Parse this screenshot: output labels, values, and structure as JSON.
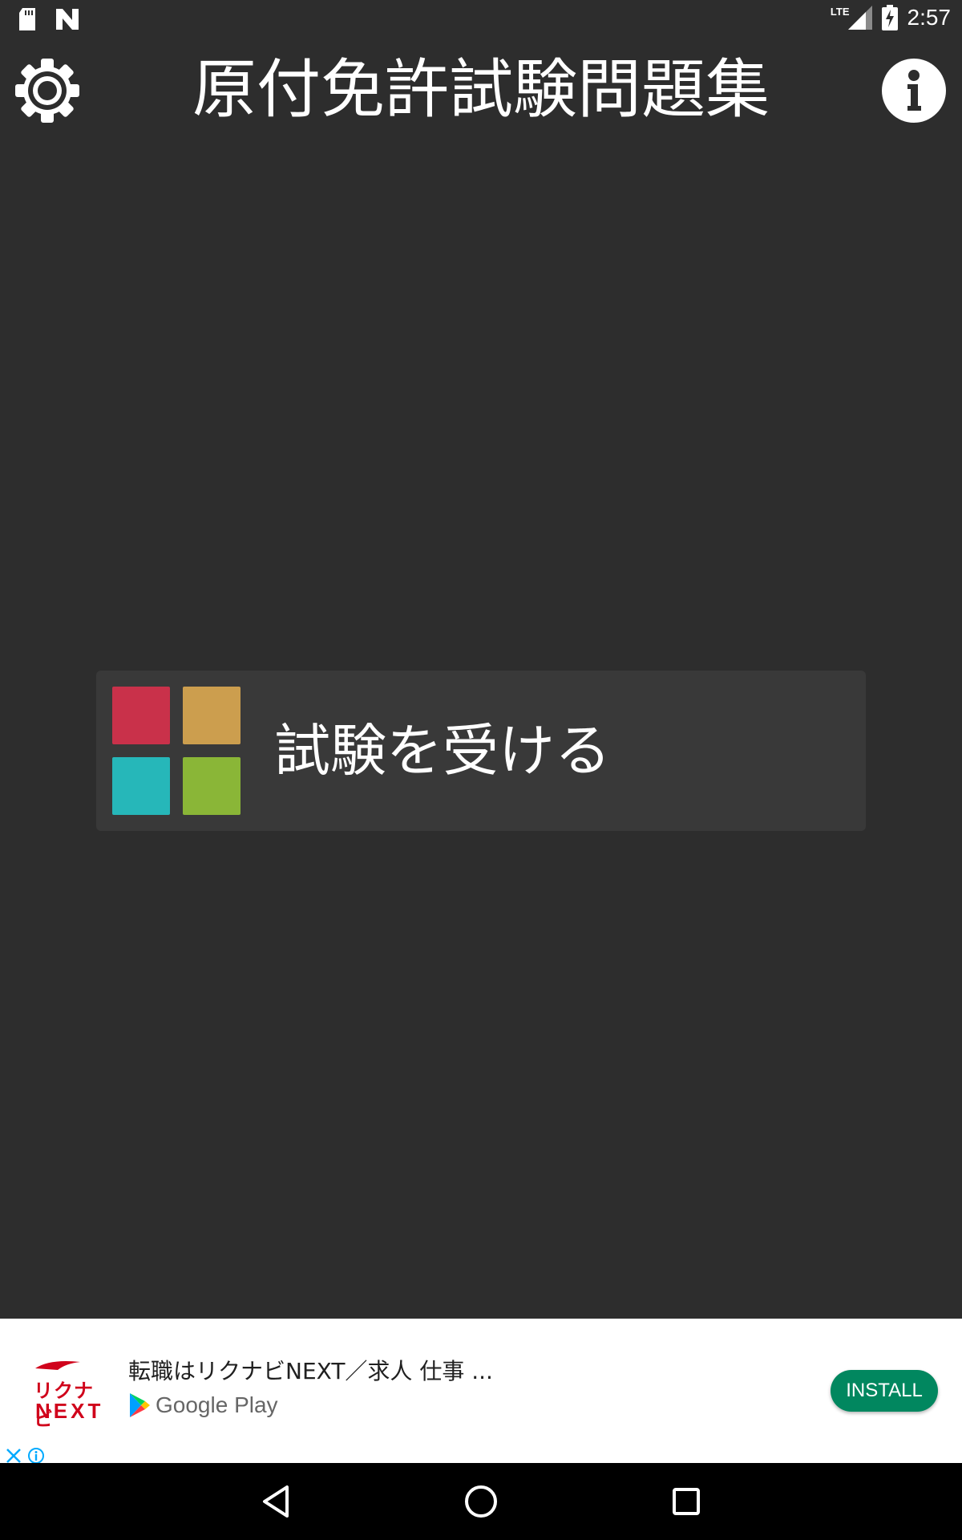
{
  "status_bar": {
    "time": "2:57",
    "icons": [
      "sd-card-icon",
      "n-logo-icon",
      "lte-icon",
      "cell-signal-icon",
      "battery-charging-icon"
    ]
  },
  "header": {
    "title": "原付免許試験問題集",
    "left_icon": "gear-icon",
    "right_icon": "info-icon"
  },
  "main": {
    "take_exam_label": "試験を受ける",
    "tile_colors": {
      "red": "#c9314a",
      "orange": "#cc9e4e",
      "teal": "#26b7b9",
      "green": "#8ab637"
    }
  },
  "ad": {
    "logo_text_jp": "リクナビ",
    "logo_text_en": "NEXT",
    "headline": "転職はリクナビNEXT／求人 仕事 ...",
    "store_label": "Google Play",
    "install_label": "INSTALL",
    "install_color": "#01875f",
    "close_icon": "close-icon",
    "info_icon": "ad-info-icon"
  },
  "nav_bar": {
    "buttons": [
      "back-icon",
      "home-icon",
      "recents-icon"
    ]
  }
}
